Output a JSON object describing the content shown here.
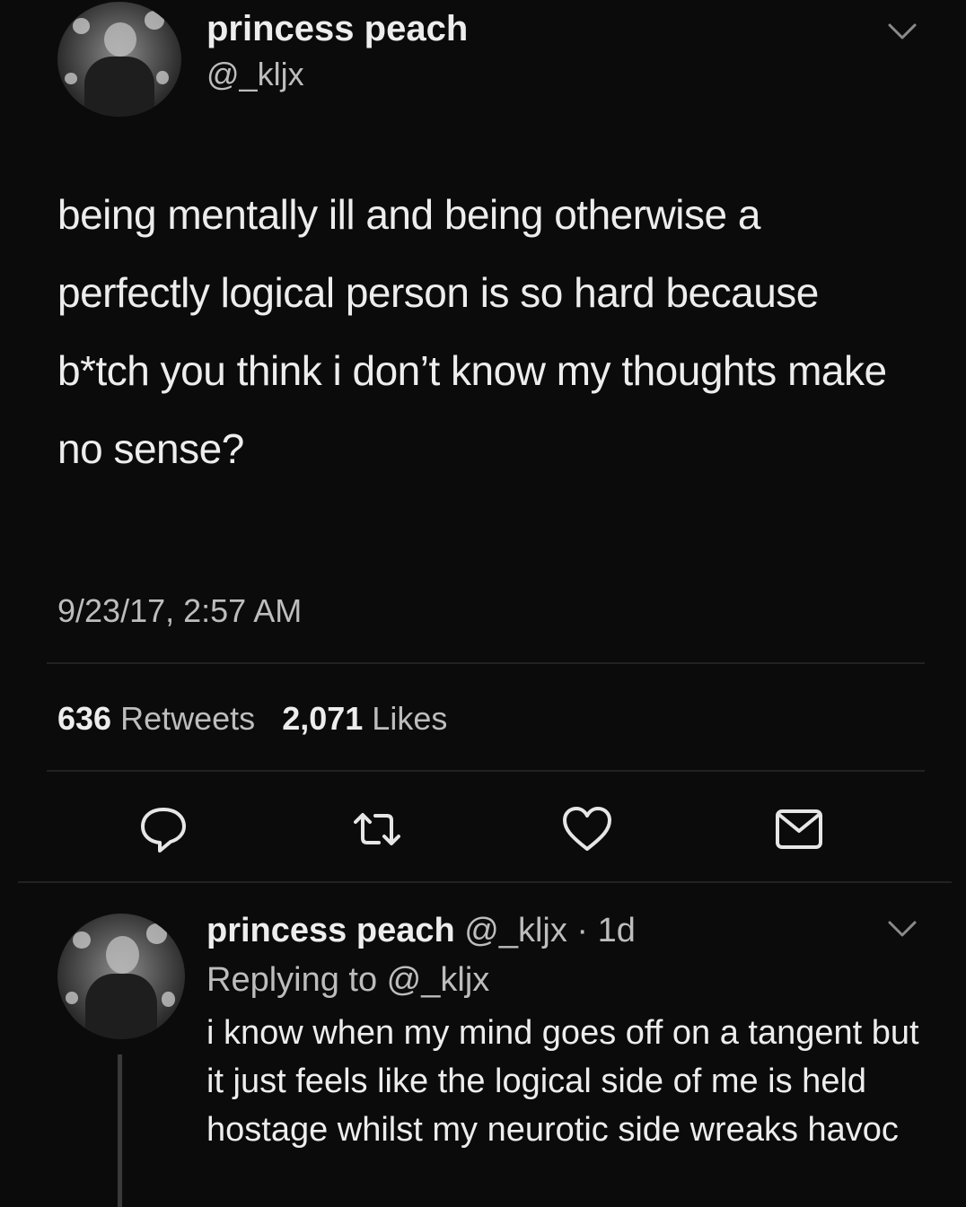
{
  "tweet": {
    "display_name": "princess peach",
    "handle": "@_kljx",
    "avatar_icon": "profile-photo",
    "menu_icon": "chevron-down-icon",
    "text": "being mentally ill and being otherwise a perfectly logical person is so hard because b*tch you think i don’t know my thoughts make no sense?",
    "timestamp": "9/23/17, 2:57 AM",
    "retweet_count": "636",
    "retweet_label": "Retweets",
    "like_count": "2,071",
    "like_label": "Likes",
    "actions": [
      {
        "icon": "reply-icon"
      },
      {
        "icon": "retweet-icon"
      },
      {
        "icon": "like-icon"
      },
      {
        "icon": "message-icon"
      }
    ]
  },
  "reply": {
    "display_name": "princess peach",
    "handle": "@_kljx",
    "separator": "·",
    "time_ago": "1d",
    "replying_to": "Replying to @_kljx",
    "text": "i know when my mind goes off on a tangent but it just feels like the logical side of me is held hostage whilst my neurotic side wreaks havoc",
    "menu_icon": "chevron-down-icon"
  },
  "colors": {
    "background": "#0b0b0b",
    "primary_text": "#ededed",
    "secondary_text": "#bdbdbd",
    "divider": "#222222"
  }
}
